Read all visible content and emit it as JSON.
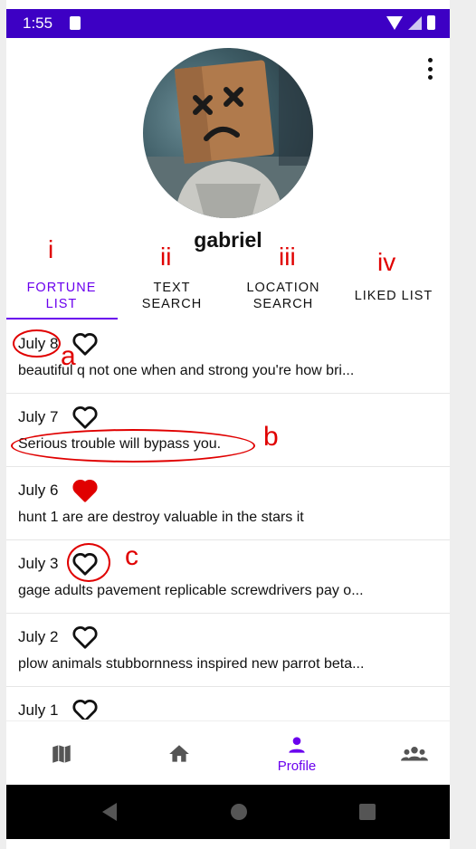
{
  "status_bar": {
    "time": "1:55"
  },
  "profile": {
    "username": "gabriel"
  },
  "annotations": {
    "tab_numerals": [
      "i",
      "ii",
      "iii",
      "iv"
    ],
    "item_letters": [
      "a",
      "b",
      "c"
    ]
  },
  "tabs": [
    {
      "line1": "FORTUNE",
      "line2": "LIST",
      "active": true
    },
    {
      "line1": "TEXT",
      "line2": "SEARCH",
      "active": false
    },
    {
      "line1": "LOCATION",
      "line2": "SEARCH",
      "active": false
    },
    {
      "line1": "LIKED LIST",
      "line2": "",
      "active": false
    }
  ],
  "fortunes": [
    {
      "date": "July 8",
      "text": "beautiful q not one when and strong you're how bri...",
      "liked": false
    },
    {
      "date": "July 7",
      "text": "Serious trouble will bypass you.",
      "liked": false
    },
    {
      "date": "July 6",
      "text": "hunt 1 are are destroy valuable in the stars it",
      "liked": true
    },
    {
      "date": "July 3",
      "text": "gage adults pavement replicable screwdrivers pay o...",
      "liked": false
    },
    {
      "date": "July 2",
      "text": "plow animals stubbornness inspired new parrot beta...",
      "liked": false
    },
    {
      "date": "July 1",
      "text": "",
      "liked": false
    }
  ],
  "bottom_nav": {
    "items": [
      {
        "icon": "map-icon",
        "label": ""
      },
      {
        "icon": "home-icon",
        "label": ""
      },
      {
        "icon": "person-icon",
        "label": "Profile"
      },
      {
        "icon": "group-icon",
        "label": ""
      }
    ],
    "active_index": 2
  },
  "colors": {
    "accent": "#6a00ee",
    "status_bar": "#3d00c4",
    "liked": "#e00000",
    "annotation": "#e00000"
  }
}
